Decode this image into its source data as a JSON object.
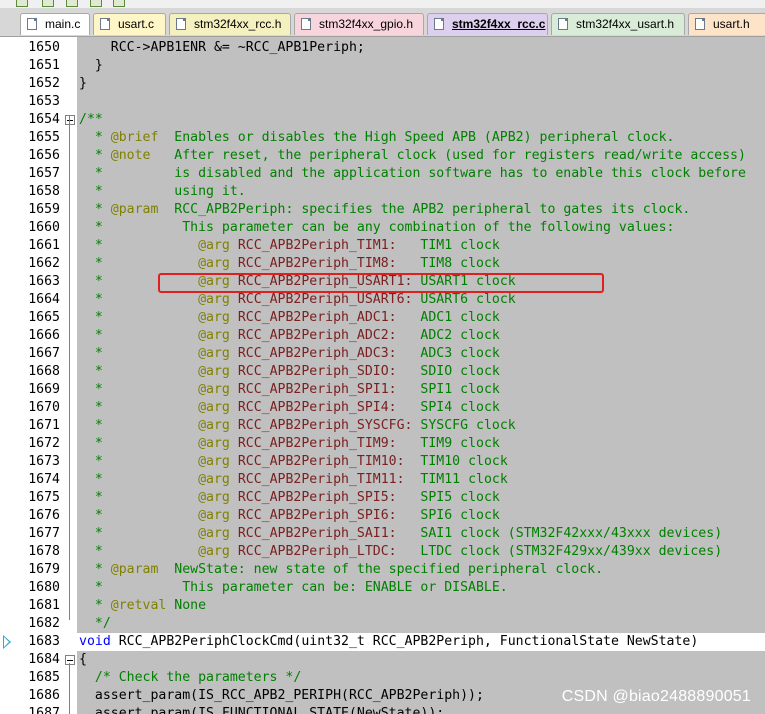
{
  "tabs": [
    {
      "label": "main.c",
      "active": false,
      "color": "#ffffff"
    },
    {
      "label": "usart.c",
      "active": false,
      "color": "#fff6c8"
    },
    {
      "label": "stm32f4xx_rcc.h",
      "active": false,
      "color": "#f4f0c0"
    },
    {
      "label": "stm32f4xx_gpio.h",
      "active": false,
      "color": "#f8d4dc"
    },
    {
      "label": "stm32f4xx_rcc.c",
      "active": true,
      "color": "#dcd0ee"
    },
    {
      "label": "stm32f4xx_usart.h",
      "active": false,
      "color": "#d8ecd8"
    },
    {
      "label": "usart.h",
      "active": false,
      "color": "#fde4c8"
    }
  ],
  "editor": {
    "current_line": "1683",
    "lines": [
      {
        "num": "1650",
        "text": "    RCC->APB1ENR &= ~RCC_APB1Periph;"
      },
      {
        "num": "1651",
        "text": "  }"
      },
      {
        "num": "1652",
        "text": "}"
      },
      {
        "num": "1653",
        "text": ""
      },
      {
        "num": "1654",
        "text": "/**"
      },
      {
        "num": "1655",
        "text": "  * @brief  Enables or disables the High Speed APB (APB2) peripheral clock."
      },
      {
        "num": "1656",
        "text": "  * @note   After reset, the peripheral clock (used for registers read/write access)"
      },
      {
        "num": "1657",
        "text": "  *         is disabled and the application software has to enable this clock before"
      },
      {
        "num": "1658",
        "text": "  *         using it."
      },
      {
        "num": "1659",
        "text": "  * @param  RCC_APB2Periph: specifies the APB2 peripheral to gates its clock."
      },
      {
        "num": "1660",
        "text": "  *          This parameter can be any combination of the following values:"
      },
      {
        "num": "1661",
        "text": "  *            @arg RCC_APB2Periph_TIM1:   TIM1 clock"
      },
      {
        "num": "1662",
        "text": "  *            @arg RCC_APB2Periph_TIM8:   TIM8 clock"
      },
      {
        "num": "1663",
        "text": "  *            @arg RCC_APB2Periph_USART1: USART1 clock"
      },
      {
        "num": "1664",
        "text": "  *            @arg RCC_APB2Periph_USART6: USART6 clock"
      },
      {
        "num": "1665",
        "text": "  *            @arg RCC_APB2Periph_ADC1:   ADC1 clock"
      },
      {
        "num": "1666",
        "text": "  *            @arg RCC_APB2Periph_ADC2:   ADC2 clock"
      },
      {
        "num": "1667",
        "text": "  *            @arg RCC_APB2Periph_ADC3:   ADC3 clock"
      },
      {
        "num": "1668",
        "text": "  *            @arg RCC_APB2Periph_SDIO:   SDIO clock"
      },
      {
        "num": "1669",
        "text": "  *            @arg RCC_APB2Periph_SPI1:   SPI1 clock"
      },
      {
        "num": "1670",
        "text": "  *            @arg RCC_APB2Periph_SPI4:   SPI4 clock"
      },
      {
        "num": "1671",
        "text": "  *            @arg RCC_APB2Periph_SYSCFG: SYSCFG clock"
      },
      {
        "num": "1672",
        "text": "  *            @arg RCC_APB2Periph_TIM9:   TIM9 clock"
      },
      {
        "num": "1673",
        "text": "  *            @arg RCC_APB2Periph_TIM10:  TIM10 clock"
      },
      {
        "num": "1674",
        "text": "  *            @arg RCC_APB2Periph_TIM11:  TIM11 clock"
      },
      {
        "num": "1675",
        "text": "  *            @arg RCC_APB2Periph_SPI5:   SPI5 clock"
      },
      {
        "num": "1676",
        "text": "  *            @arg RCC_APB2Periph_SPI6:   SPI6 clock"
      },
      {
        "num": "1677",
        "text": "  *            @arg RCC_APB2Periph_SAI1:   SAI1 clock (STM32F42xxx/43xxx devices)"
      },
      {
        "num": "1678",
        "text": "  *            @arg RCC_APB2Periph_LTDC:   LTDC clock (STM32F429xx/439xx devices)"
      },
      {
        "num": "1679",
        "text": "  * @param  NewState: new state of the specified peripheral clock."
      },
      {
        "num": "1680",
        "text": "  *          This parameter can be: ENABLE or DISABLE."
      },
      {
        "num": "1681",
        "text": "  * @retval None"
      },
      {
        "num": "1682",
        "text": "  */"
      },
      {
        "num": "1683",
        "text": "void RCC_APB2PeriphClockCmd(uint32_t RCC_APB2Periph, FunctionalState NewState)"
      },
      {
        "num": "1684",
        "text": "{"
      },
      {
        "num": "1685",
        "text": "  /* Check the parameters */"
      },
      {
        "num": "1686",
        "text": "  assert_param(IS_RCC_APB2_PERIPH(RCC_APB2Periph));"
      },
      {
        "num": "1687",
        "text": "  assert_param(IS_FUNCTIONAL_STATE(NewState));"
      }
    ]
  },
  "watermark": "CSDN @biao2488890051",
  "colors": {
    "comment": "#008000",
    "doc_tag": "#808000",
    "arg_name": "#7a2020",
    "keyword": "#0000ff",
    "highlight_box": "#e02020"
  }
}
